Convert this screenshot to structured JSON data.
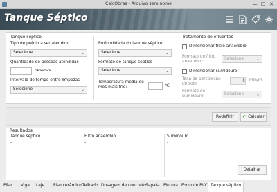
{
  "window": {
    "title": "CalcObras - Arquivo sem nome",
    "minimize_glyph": "—",
    "maximize_glyph": "☐",
    "close_glyph": "✕"
  },
  "header": {
    "title": "Tanque Séptico",
    "icons": [
      "menu-icon",
      "document-icon",
      "tag-icon",
      "gear-icon"
    ]
  },
  "tanque": {
    "section_title": "Tanque séptico",
    "tipo_label": "Tipo de prédio a ser atendido",
    "tipo_value": "Selecione",
    "pessoas_label": "Quantidade de pessoas atendidas",
    "pessoas_value": "",
    "pessoas_unit": "pessoas",
    "intervalo_label": "Intervalo de tempo entre limpezas",
    "intervalo_value": "Selecione",
    "profundidade_label": "Profundidade do tanque séptico",
    "profundidade_value": "Selecione",
    "formato_label": "Formato do tanque séptico",
    "formato_value": "Selecione",
    "temperatura_label_1": "Temperatura média do",
    "temperatura_label_2": "mês mais frio:",
    "temperatura_value": "",
    "temperatura_unit": "ºC"
  },
  "efluentes": {
    "section_title": "Tratamento de efluentes",
    "filtro_check_label": "Dimensionar filtro anaeróbio",
    "filtro_check_checked": false,
    "formato_filtro_label_1": "Formato do filtro",
    "formato_filtro_label_2": "anaeróbio:",
    "formato_filtro_value": "Selecione",
    "sumidouro_check_label": "Dimensionar sumidouro",
    "sumidouro_check_checked": false,
    "taxa_label_1": "Taxa de percolação",
    "taxa_label_2": "do solo:",
    "taxa_unit": "min/m",
    "formato_sumidouro_label_1": "Formato do",
    "formato_sumidouro_label_2": "sumidouro:",
    "formato_sumidouro_value": "Selecione"
  },
  "actions": {
    "redefinir": "Redefinir",
    "calcular": "Calcular",
    "calcular_icon": "✔"
  },
  "resultados": {
    "title": "Resultados",
    "col1_title": "Tanque séptico",
    "col1_value": "-",
    "col2_title": "Filtro anaeróbio",
    "col2_value": "-",
    "col3_title": "Sumidouro",
    "col3_value": "-",
    "detalhar": "Detalhar"
  },
  "tabs": [
    "Pilar",
    "Viga",
    "Laje",
    "Piso cerâmico",
    "Telhado",
    "Dosagem de concreto",
    "Sapata",
    "Pintura",
    "Forro de PVC",
    "Tanque séptico"
  ],
  "active_tab": "Tanque séptico",
  "chevron_glyph": "⌄",
  "colors": {
    "header_dark": "#3a4a55",
    "calcular_check": "#2e9e3e"
  }
}
